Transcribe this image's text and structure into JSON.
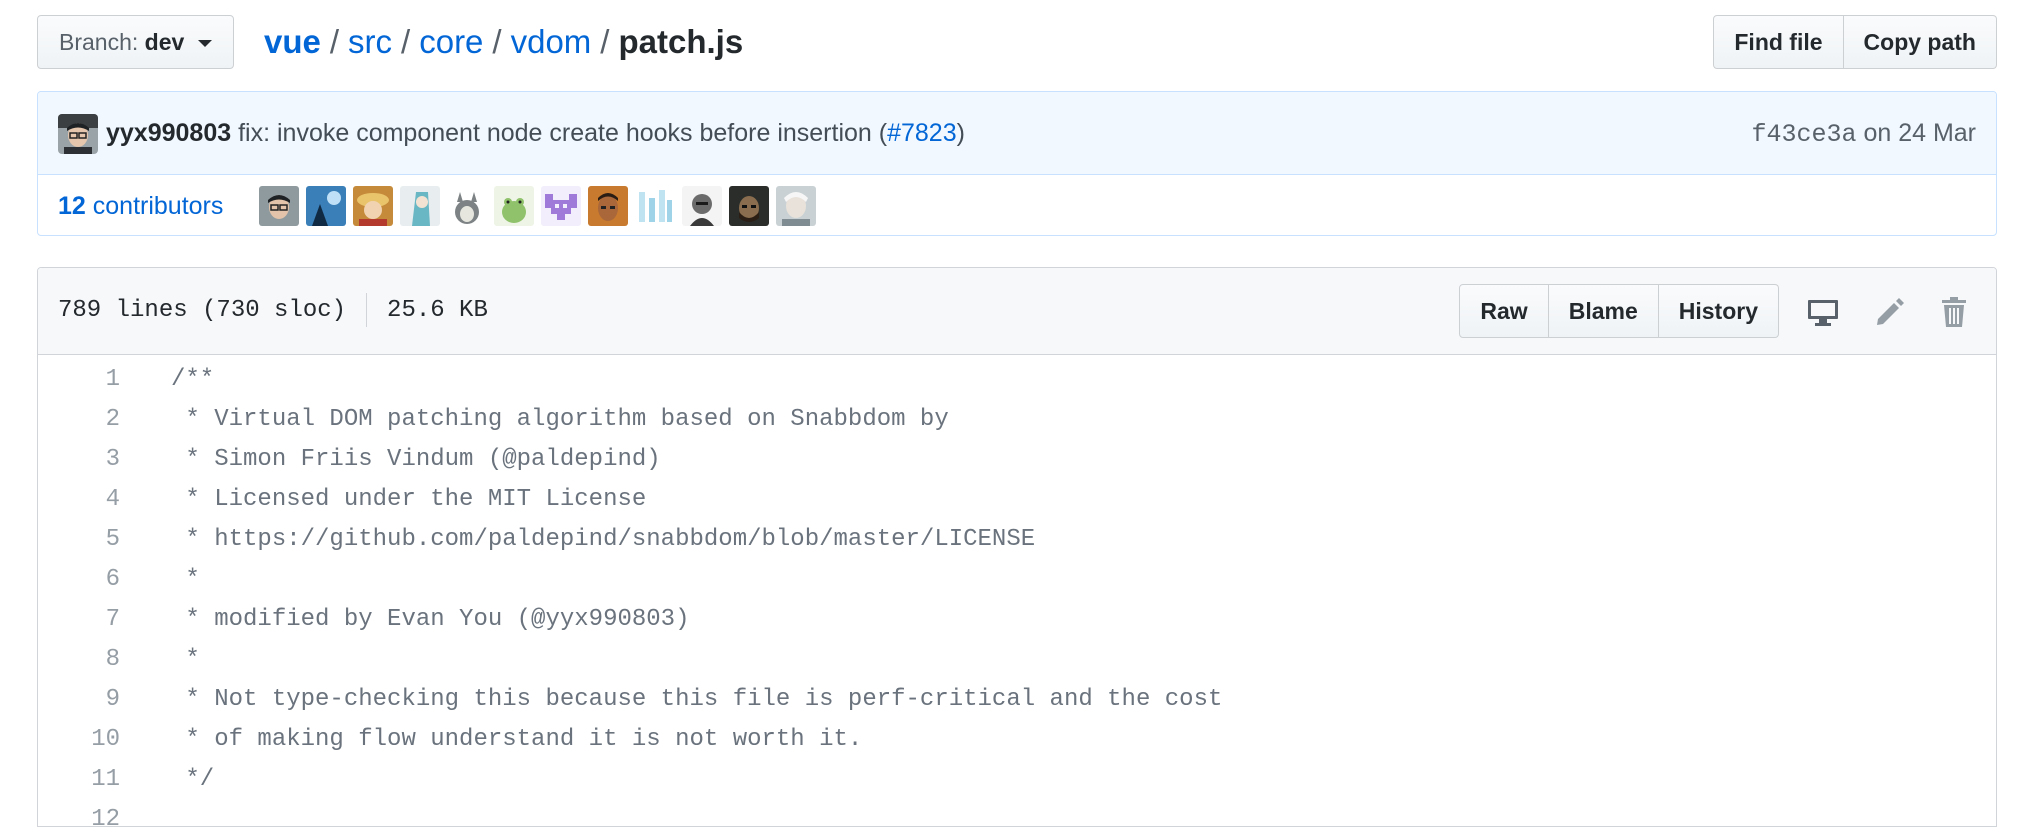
{
  "branch": {
    "label": "Branch:",
    "name": "dev"
  },
  "breadcrumb": {
    "repo": "vue",
    "dirs": [
      "src",
      "core",
      "vdom"
    ],
    "file": "patch.js",
    "separator": "/"
  },
  "actions": {
    "find_file": "Find file",
    "copy_path": "Copy path"
  },
  "commit": {
    "author": "yyx990803",
    "message_prefix": "fix: invoke component node create hooks before insertion (",
    "pr": "#7823",
    "message_suffix": ")",
    "sha": "f43ce3a",
    "date_text": "on 24 Mar"
  },
  "contributors": {
    "count": "12",
    "label": "contributors"
  },
  "file": {
    "lines_info": "789 lines (730 sloc)",
    "size": "25.6 KB",
    "raw": "Raw",
    "blame": "Blame",
    "history": "History"
  },
  "code_lines": [
    {
      "n": "1",
      "text": "/**"
    },
    {
      "n": "2",
      "text": " * Virtual DOM patching algorithm based on Snabbdom by"
    },
    {
      "n": "3",
      "text": " * Simon Friis Vindum (@paldepind)"
    },
    {
      "n": "4",
      "text": " * Licensed under the MIT License"
    },
    {
      "n": "5",
      "text": " * https://github.com/paldepind/snabbdom/blob/master/LICENSE"
    },
    {
      "n": "6",
      "text": " *"
    },
    {
      "n": "7",
      "text": " * modified by Evan You (@yyx990803)"
    },
    {
      "n": "8",
      "text": " *"
    },
    {
      "n": "9",
      "text": " * Not type-checking this because this file is perf-critical and the cost"
    },
    {
      "n": "10",
      "text": " * of making flow understand it is not worth it."
    },
    {
      "n": "11",
      "text": " */"
    },
    {
      "n": "12",
      "text": ""
    }
  ],
  "icons": {
    "desktop": "desktop-icon",
    "edit": "pencil-icon",
    "delete": "trash-icon",
    "dropdown": "caret-down-icon"
  },
  "colors": {
    "link": "#0366d6",
    "commit_bg": "#f1f8ff",
    "commit_border": "#c8e1ff",
    "header_bg": "#f6f8fa",
    "line_number": "#959da5",
    "comment": "#6a737d"
  }
}
